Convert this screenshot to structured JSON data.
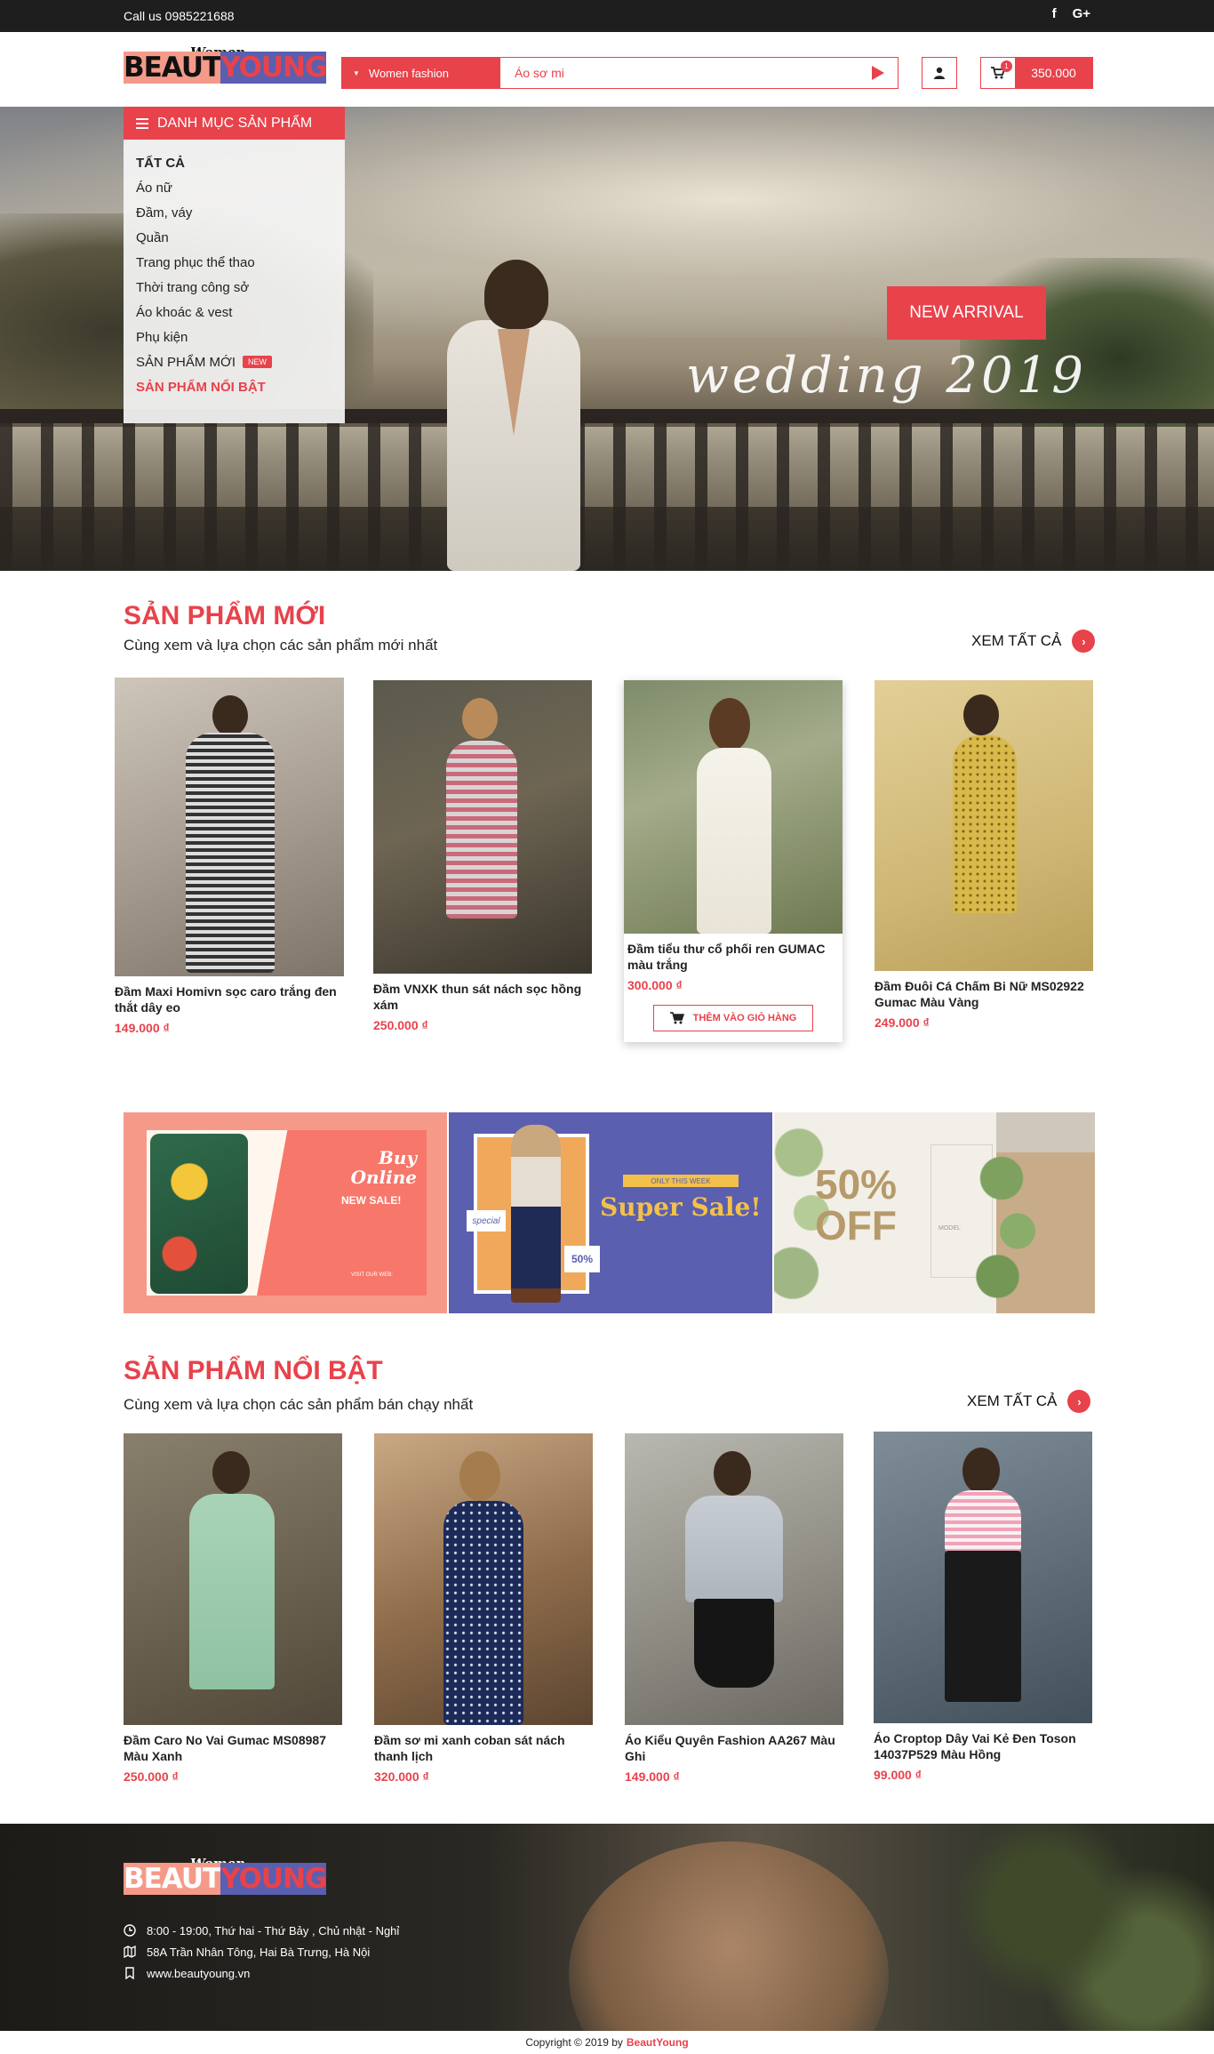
{
  "topbar": {
    "phone": "Call us 0985221688",
    "social": [
      "f",
      "G+"
    ]
  },
  "header": {
    "logo_tagline": "Women Fashion",
    "logo_brand_1": "BEAUT",
    "logo_brand_2": "YOUNG",
    "search_category": "Women fashion",
    "search_value": "Áo sơ mi",
    "cart_count": "1",
    "cart_total": "350.000"
  },
  "hero": {
    "button": "NEW ARRIVAL",
    "script_text": "wedding 2019"
  },
  "category_menu": {
    "title": "DANH MỤC SẢN PHẨM",
    "items": [
      {
        "label": "TẤT CẢ"
      },
      {
        "label": "Áo nữ"
      },
      {
        "label": "Đầm, váy"
      },
      {
        "label": "Quần"
      },
      {
        "label": "Trang phục thể thao"
      },
      {
        "label": "Thời trang công sở"
      },
      {
        "label": "Áo khoác & vest"
      },
      {
        "label": "Phụ kiện"
      },
      {
        "label": "SẢN PHẨM MỚI",
        "badge": "NEW"
      },
      {
        "label": "SẢN PHẨM NỔI BẬT"
      }
    ]
  },
  "new_products": {
    "title": "SẢN PHẨM MỚI",
    "subtitle": "Cùng xem và lựa chọn các sản phẩm mới nhất",
    "see_all": "XEM TẤT CẢ",
    "items": [
      {
        "name": "Đầm Maxi Homivn sọc caro trắng đen thắt dây eo",
        "price": "149.000 ₫"
      },
      {
        "name": "Đầm VNXK thun sát nách sọc hồng xám",
        "price": "250.000 ₫"
      },
      {
        "name": "Đầm tiểu thư cổ phối ren GUMAC màu trắng",
        "price": "300.000 ₫",
        "button": "THÊM VÀO GIỎ HÀNG"
      },
      {
        "name": "Đầm Đuôi Cá Chấm Bi Nữ MS02922 Gumac Màu Vàng",
        "price": "249.000 ₫"
      }
    ]
  },
  "banners": {
    "b1": {
      "title_1": "Buy",
      "title_2": "Online",
      "sale": "NEW SALE!",
      "footer": "VISIT OUR WEB:"
    },
    "b2": {
      "special": "special",
      "only": "ONLY THIS WEEK",
      "super": "Super Sale!",
      "pct": "50%"
    },
    "b3": {
      "pct_1": "50%",
      "pct_2": "OFF",
      "model": "MODEL"
    }
  },
  "featured_products": {
    "title": "SẢN PHẨM NỔI BẬT",
    "subtitle": "Cùng xem và lựa chọn các sản phẩm bán chạy nhất",
    "see_all": "XEM TẤT CẢ",
    "items": [
      {
        "name": "Đầm Caro No Vai Gumac MS08987 Màu Xanh",
        "price": "250.000 ₫"
      },
      {
        "name": "Đầm sơ mi xanh coban sát nách thanh lịch",
        "price": "320.000 ₫"
      },
      {
        "name": "Áo Kiểu Quyên Fashion AA267 Màu Ghi",
        "price": "149.000 ₫"
      },
      {
        "name": "Áo Croptop Dây Vai Kẻ Đen Toson 14037P529 Màu Hồng",
        "price": "99.000 ₫"
      }
    ]
  },
  "footer": {
    "hours": "8:00 - 19:00, Thứ hai - Thứ Bảy , Chủ nhật - Nghỉ",
    "address": "58A Trần Nhân Tông, Hai Bà Trưng, Hà Nội",
    "website": "www.beautyoung.vn",
    "copyright_prefix": "Copyright © 2019 by",
    "copyright_brand": "BeautYoung"
  },
  "colors": {
    "accent": "#e8424b",
    "topbar": "#1e1e1e"
  },
  "icons": [
    "facebook-icon",
    "google-plus-icon",
    "search-submit-icon",
    "user-icon",
    "cart-icon",
    "menu-icon",
    "chevron-right-icon",
    "clock-icon",
    "map-icon",
    "bookmark-icon"
  ]
}
